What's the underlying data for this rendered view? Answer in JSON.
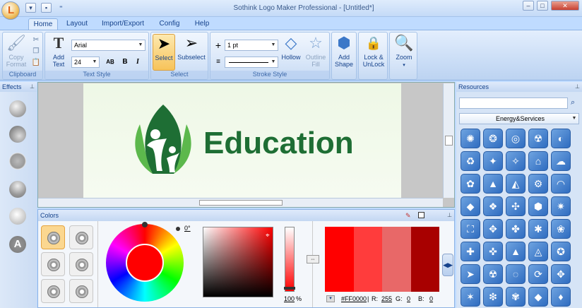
{
  "window": {
    "title": "Sothink Logo Maker Professional - [Untitled*]"
  },
  "tabs": [
    "Home",
    "Layout",
    "Import/Export",
    "Config",
    "Help"
  ],
  "ribbon": {
    "clipboard": {
      "copy_format": "Copy\nFormat",
      "label": "Clipboard"
    },
    "text_style": {
      "add_text": "Add\nText",
      "font": "Arial",
      "size": "24",
      "label": "Text Style"
    },
    "select": {
      "select": "Select",
      "subselect": "Subselect",
      "label": "Select"
    },
    "stroke": {
      "width": "1 pt",
      "hollow": "Hollow",
      "outline_fill": "Outline\nFill",
      "label": "Stroke Style"
    },
    "add_shape": "Add\nShape",
    "lock": "Lock &\nUnLock",
    "zoom": "Zoom"
  },
  "effects": {
    "title": "Effects"
  },
  "canvas": {
    "logo_text": "Education"
  },
  "colors": {
    "title": "Colors",
    "angle": "0°",
    "percent": "100",
    "percent_unit": "%",
    "hex": "#FF0000",
    "r_label": "R:",
    "r_value": "255",
    "g_label": "G:",
    "g_value": "0",
    "b_label": "B:",
    "b_value": "0",
    "swatches": [
      "#ff0000",
      "#ff3c3c",
      "#e86868",
      "#a80000"
    ]
  },
  "resources": {
    "title": "Resources",
    "search_placeholder": "",
    "category": "Energy&Services"
  },
  "accent": {
    "logo_green": "#1e6e34",
    "light_green": "#5cb84c"
  }
}
